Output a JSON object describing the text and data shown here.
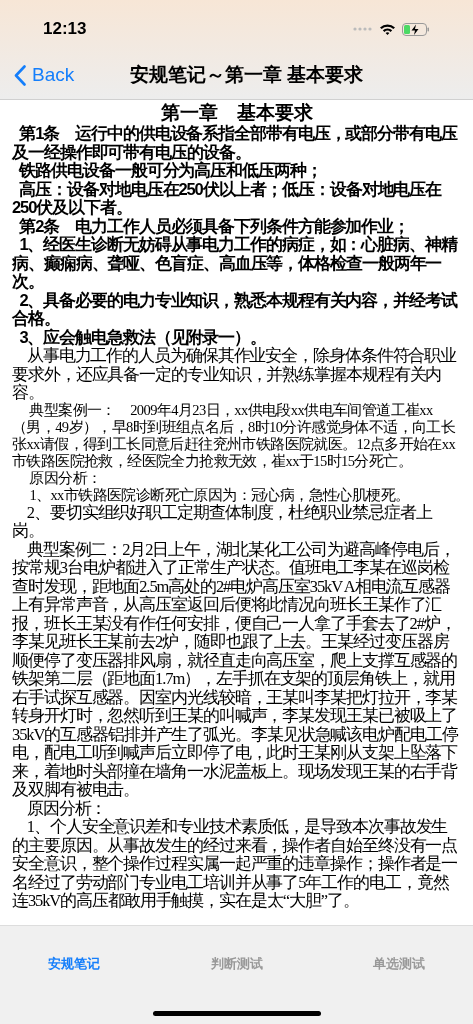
{
  "status_bar": {
    "time": "12:13"
  },
  "nav": {
    "back": "Back",
    "title": "安规笔记～第一章 基本要求"
  },
  "paragraphs": [
    {
      "kind": "title",
      "text": "第一章　基本要求"
    },
    {
      "kind": "bold",
      "text": "第1条　运行中的供电设备系指全部带有电压，或部分带有电压及一经操作即可带有电压的设备。"
    },
    {
      "kind": "bold",
      "text": "铁路供电设备一般可分为高压和低压两种；"
    },
    {
      "kind": "bold",
      "text": "高压：设备对地电压在250伏以上者；低压：设备对地电压在250伏及以下者。"
    },
    {
      "kind": "bold",
      "text": "第2条　电力工作人员必须具备下列条件方能参加作业；"
    },
    {
      "kind": "bold",
      "text": "1、经医生诊断无妨碍从事电力工作的病症，如：心脏病、神精病、癫痫病、聋哑、色盲症、高血压等，体格检查一般两年一次。"
    },
    {
      "kind": "bold",
      "text": "2、具备必要的电力专业知识，熟悉本规程有关内容，并经考试合格。"
    },
    {
      "kind": "bold",
      "text": "3、应会触电急救法（见附录一）。"
    },
    {
      "kind": "plain",
      "text": "从事电力工作的人员为确保其作业安全，除身体条件符合职业要求外，还应具备一定的专业知识，并熟练掌握本规程有关内容。"
    },
    {
      "kind": "small",
      "text": "典型案例一：　2009年4月23日，xx供电段xx供电车间管道工崔xx（男，49岁），早8时到班组点名后，8时10分许感觉身体不适，向工长张xx请假，得到工长同意后赶往兖州市铁路医院就医。12点多开始在xx市铁路医院抢救，经医院全力抢救无效，崔xx于15时15分死亡。"
    },
    {
      "kind": "small",
      "text": "原因分析："
    },
    {
      "kind": "small",
      "text": "1、xx市铁路医院诊断死亡原因为：冠心病，急性心肌梗死。"
    },
    {
      "kind": "serif",
      "text": "2、要切实组织好职工定期查体制度，杜绝职业禁忌症者上岗。"
    },
    {
      "kind": "serif",
      "text": "典型案例二：2月2日上午，湖北某化工公司为避高峰停电后，按常规3台电炉都进入了正常生产状态。值班电工李某在巡岗检查时发现，距地面2.5m高处的2#电炉高压室35kV A相电流互感器上有异常声音，从高压室返回后便将此情况向班长王某作了汇报，班长王某没有作任何安排，便自己一人拿了手套去了2#炉，李某见班长王某前去2炉，随即也跟了上去。王某经过变压器房顺便停了变压器排风扇，就径直走向高压室，爬上支撑互感器的铁架第二层（距地面1.7m），左手抓在支架的顶层角铁上，就用右手试探互感器。因室内光线较暗，王某叫李某把灯拉开，李某转身开灯时，忽然听到王某的叫喊声，李某发现王某已被吸上了35kV的互感器铝排并产生了弧光。李某见状急喊该电炉配电工停电，配电工听到喊声后立即停了电，此时王某刚从支架上坠落下来，着地时头部撞在墙角一水泥盖板上。现场发现王某的右手背及双脚有被电击。"
    },
    {
      "kind": "serif",
      "text": "原因分析："
    },
    {
      "kind": "serif",
      "text": "1、个人安全意识差和专业技术素质低，是导致本次事故发生的主要原因。从事故发生的经过来看，操作者自始至终没有一点安全意识，整个操作过程实属一起严重的违章操作；操作者是一名经过了劳动部门专业电工培训并从事了5年工作的电工，竟然连35kV的高压都敢用手触摸，实在是太“大胆”了。"
    }
  ],
  "tabs": [
    {
      "label": "安规笔记",
      "selected": true
    },
    {
      "label": "判断测试",
      "selected": false
    },
    {
      "label": "单选测试",
      "selected": false
    }
  ]
}
